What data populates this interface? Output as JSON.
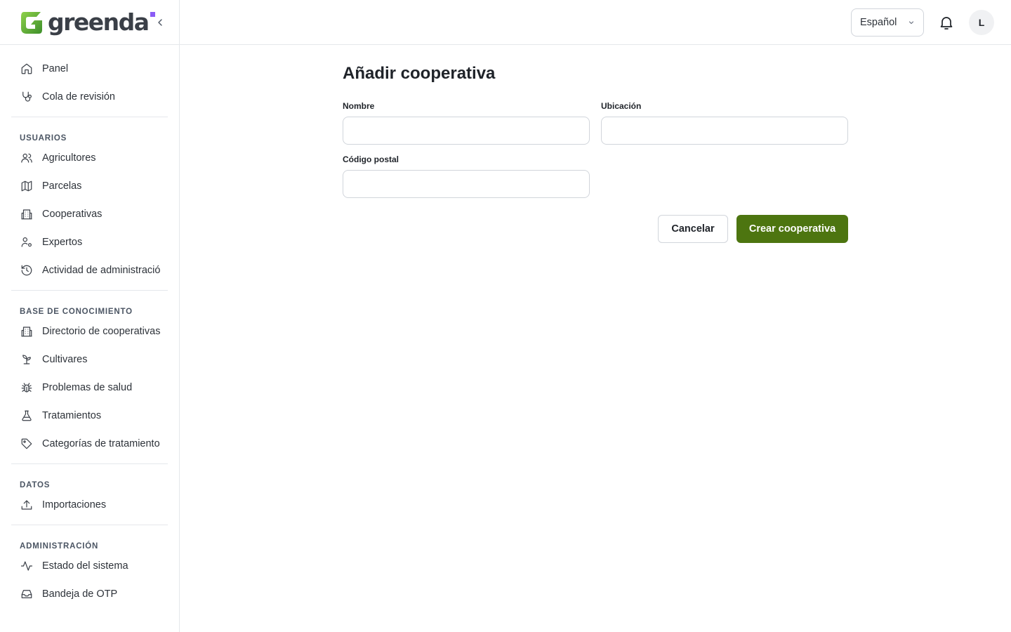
{
  "brand": {
    "name": "greenda",
    "accent": "#8b5cf6",
    "primary": "#4d7510"
  },
  "header": {
    "language": "Español",
    "avatar_initial": "L"
  },
  "sidebar": {
    "top": [
      {
        "label": "Panel",
        "icon": "home-icon"
      },
      {
        "label": "Cola de revisión",
        "icon": "stethoscope-icon"
      }
    ],
    "groups": [
      {
        "title": "USUARIOS",
        "items": [
          {
            "label": "Agricultores",
            "icon": "users-icon"
          },
          {
            "label": "Parcelas",
            "icon": "map-icon"
          },
          {
            "label": "Cooperativas",
            "icon": "building-icon"
          },
          {
            "label": "Expertos",
            "icon": "user-cog-icon"
          },
          {
            "label": "Actividad de administración",
            "icon": "history-icon"
          }
        ]
      },
      {
        "title": "BASE DE CONOCIMIENTO",
        "items": [
          {
            "label": "Directorio de cooperativas",
            "icon": "building-icon"
          },
          {
            "label": "Cultivares",
            "icon": "sprout-icon"
          },
          {
            "label": "Problemas de salud",
            "icon": "bug-icon"
          },
          {
            "label": "Tratamientos",
            "icon": "flask-icon"
          },
          {
            "label": "Categorías de tratamientos",
            "icon": "tag-icon"
          }
        ]
      },
      {
        "title": "DATOS",
        "items": [
          {
            "label": "Importaciones",
            "icon": "upload-icon"
          }
        ]
      },
      {
        "title": "ADMINISTRACIÓN",
        "items": [
          {
            "label": "Estado del sistema",
            "icon": "activity-icon"
          },
          {
            "label": "Bandeja de OTP",
            "icon": "inbox-icon"
          }
        ]
      }
    ]
  },
  "form": {
    "title": "Añadir cooperativa",
    "fields": {
      "name": {
        "label": "Nombre",
        "value": ""
      },
      "location": {
        "label": "Ubicación",
        "value": ""
      },
      "postal_code": {
        "label": "Código postal",
        "value": ""
      }
    },
    "cancel_label": "Cancelar",
    "submit_label": "Crear cooperativa"
  }
}
